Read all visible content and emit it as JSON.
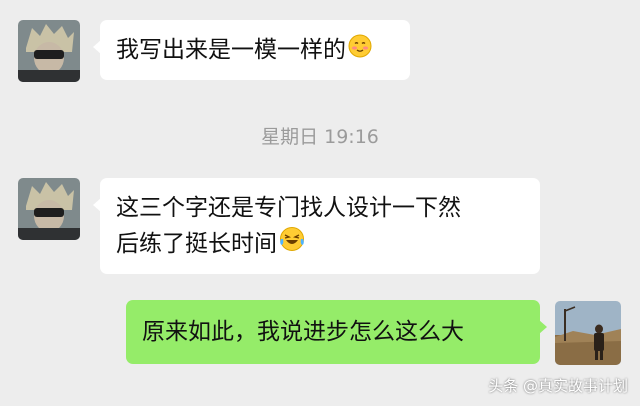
{
  "chat": {
    "messages": [
      {
        "side": "left",
        "text": "我写出来是一模一样的",
        "emoji": "blush-face-icon"
      },
      {
        "side": "left",
        "line1": "这三个字还是专门找人设计一下然",
        "line2": "后练了挺长时间",
        "emoji": "laughing-tears-face-icon"
      },
      {
        "side": "right",
        "text": "原来如此，我说进步怎么这么大"
      }
    ],
    "timestamp": "星期日 19:16"
  },
  "watermark": "头条 @真实故事计划",
  "colors": {
    "background": "#ededed",
    "incoming_bubble": "#ffffff",
    "outgoing_bubble": "#95ec69",
    "timestamp": "#9b9b9b"
  }
}
